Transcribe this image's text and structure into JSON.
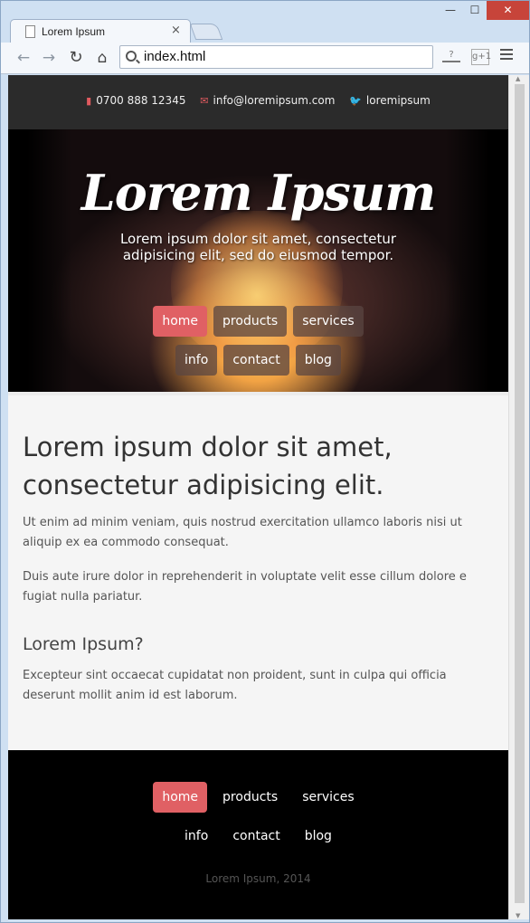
{
  "browser": {
    "tab_title": "Lorem Ipsum",
    "tab_close": "×",
    "url": "index.html",
    "window_controls": {
      "minimize": "—",
      "maximize": "☐",
      "close": "✕"
    },
    "nav_icons": {
      "back": "arrow-left-icon",
      "forward": "arrow-right-icon",
      "reload": "reload-icon",
      "home": "home-icon"
    },
    "toolbar_icons": {
      "help": "?",
      "gplus": "g+1",
      "menu": "menu-icon"
    }
  },
  "site": {
    "contacts": [
      {
        "icon": "phone-icon",
        "glyph": "▮",
        "text": "0700 888 12345"
      },
      {
        "icon": "email-icon",
        "glyph": "✉",
        "text": "info@loremipsum.com"
      },
      {
        "icon": "twitter-icon",
        "glyph": "🐦",
        "text": "loremipsum"
      }
    ],
    "hero": {
      "title": "Lorem Ipsum",
      "subtitle": "Lorem ipsum dolor sit amet, consectetur adipisicing elit, sed do eiusmod tempor."
    },
    "nav": {
      "row1": [
        "home",
        "products",
        "services"
      ],
      "row2": [
        "info",
        "contact",
        "blog"
      ],
      "active": "home"
    },
    "content": {
      "heading": "Lorem ipsum dolor sit amet, consectetur adipisicing elit.",
      "para1_line1": "Ut enim ad minim veniam, quis nostrud exercitation ullamco laboris nisi ut",
      "para1_line2": "aliquip ex ea commodo consequat.",
      "para2_line1": "Duis aute irure dolor in reprehenderit in voluptate velit esse cillum dolore e",
      "para2_line2": "fugiat nulla pariatur.",
      "subheading": "Lorem Ipsum?",
      "para3_line1": "Excepteur sint occaecat cupidatat non proident, sunt in culpa qui officia",
      "para3_line2": "deserunt mollit anim id est laborum."
    },
    "footer": {
      "copyright": "Lorem Ipsum, 2014"
    }
  },
  "colors": {
    "accent": "#e06064",
    "topbar": "#2b2b2b",
    "footer": "#000000",
    "content_bg": "#f5f5f5"
  }
}
